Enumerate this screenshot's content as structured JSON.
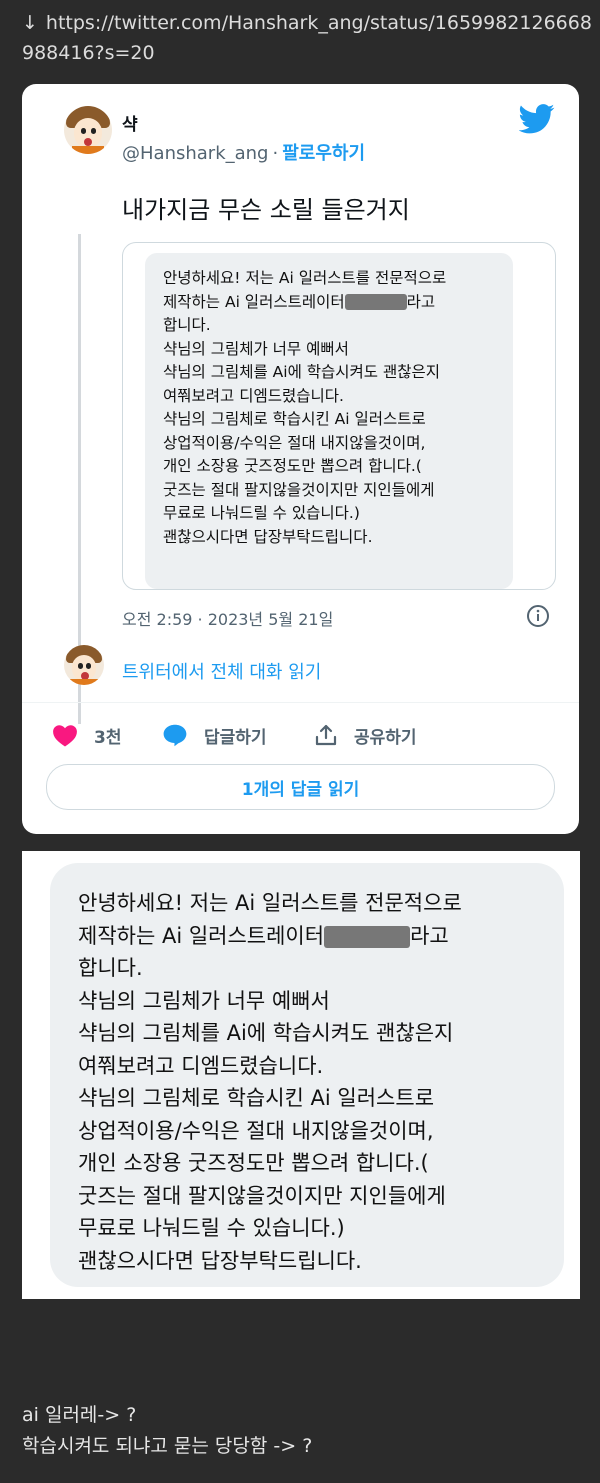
{
  "link": {
    "arrow": "↓",
    "url": "https://twitter.com/Hanshark_ang/status/1659982126668988416?s=20"
  },
  "tweet": {
    "author_name": "샥",
    "handle": "@Hanshark_ang",
    "separator": "·",
    "follow_label": "팔로우하기",
    "text": "내가지금 무슨 소릴 들은거지",
    "quoted_message_lines": [
      "안녕하세요! 저는 Ai 일러스트를 전문적으로",
      "제작하는 Ai 일러스트레이터",
      "라고",
      "합니다.",
      "샥님의 그림체가 너무 예뻐서",
      "샥님의 그림체를 Ai에 학습시켜도 괜찮은지",
      "여쭤보려고 디엠드렸습니다.",
      "샥님의 그림체로 학습시킨 Ai 일러스트로",
      "상업적이용/수익은 절대 내지않을것이며,",
      "개인 소장용 굿즈정도만 뽑으려 합니다.(",
      "굿즈는 절대 팔지않을것이지만 지인들에게",
      "무료로 나눠드릴 수 있습니다.)",
      "괜찮으시다면 답장부탁드립니다."
    ],
    "timestamp": "오전 2:59 · 2023년 5월 21일",
    "read_conversation": "트위터에서 전체 대화 읽기",
    "like_count": "3천",
    "reply_label": "답글하기",
    "share_label": "공유하기",
    "read_replies_label": "1개의 답글 읽기",
    "colors": {
      "accent": "#1d9bf0",
      "like": "#f91880",
      "text_secondary": "#536471"
    }
  },
  "caption": {
    "line1": "ai 일러레-> ?",
    "line2": "학습시켜도 되냐고 묻는 당당함 -> ?"
  }
}
